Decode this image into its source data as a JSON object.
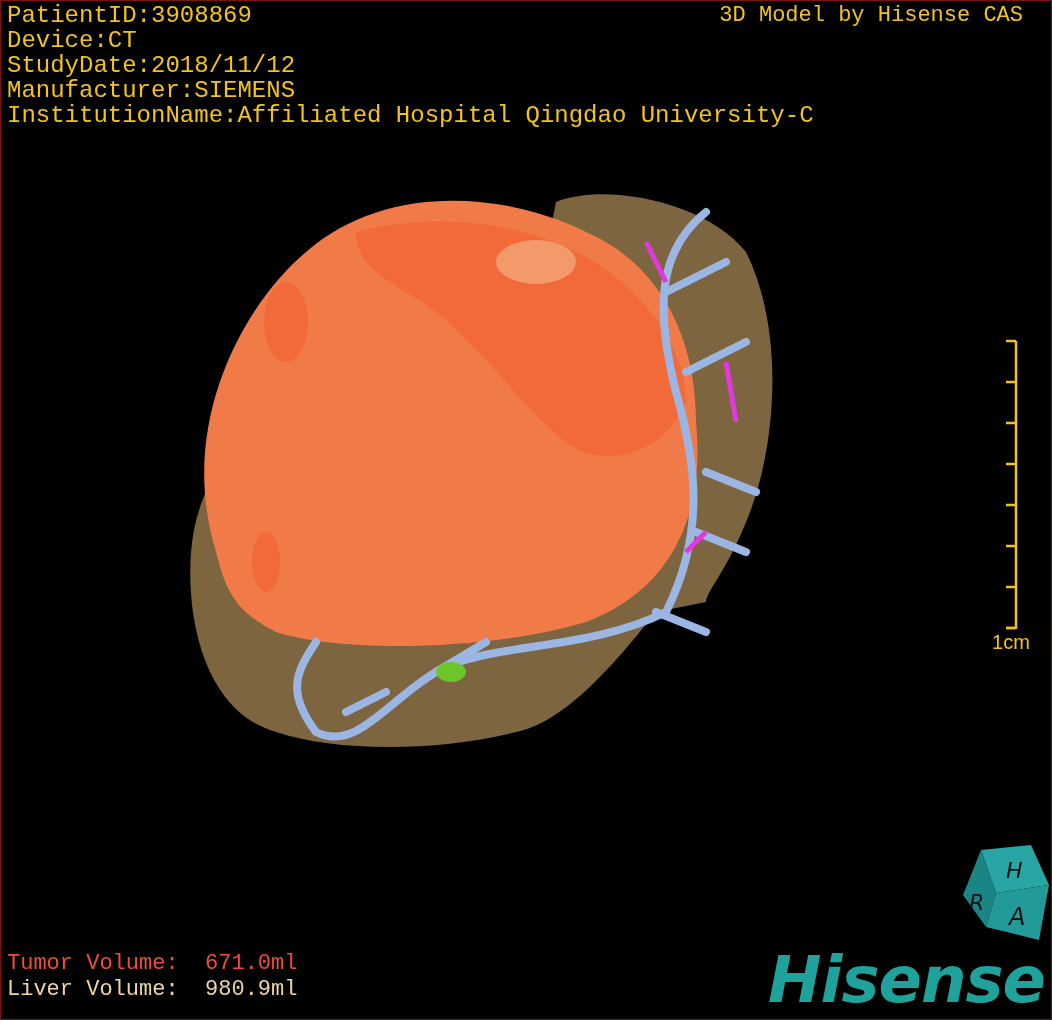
{
  "header": {
    "info_lines": [
      "PatientID:3908869",
      "Device:CT",
      "StudyDate:2018/11/12",
      "Manufacturer:SIEMENS",
      "InstitutionName:Affiliated Hospital Qingdao University-C"
    ],
    "title": "3D Model by Hisense CAS"
  },
  "scale_bar": {
    "label": "1cm"
  },
  "volumes": [
    {
      "kind": "tumor",
      "text": "Tumor Volume:  671.0ml"
    },
    {
      "kind": "liver",
      "text": "Liver Volume:  980.9ml"
    }
  ],
  "orientation_cube": {
    "top": "H",
    "left": "R",
    "front": "A"
  },
  "logo": "Hisense"
}
